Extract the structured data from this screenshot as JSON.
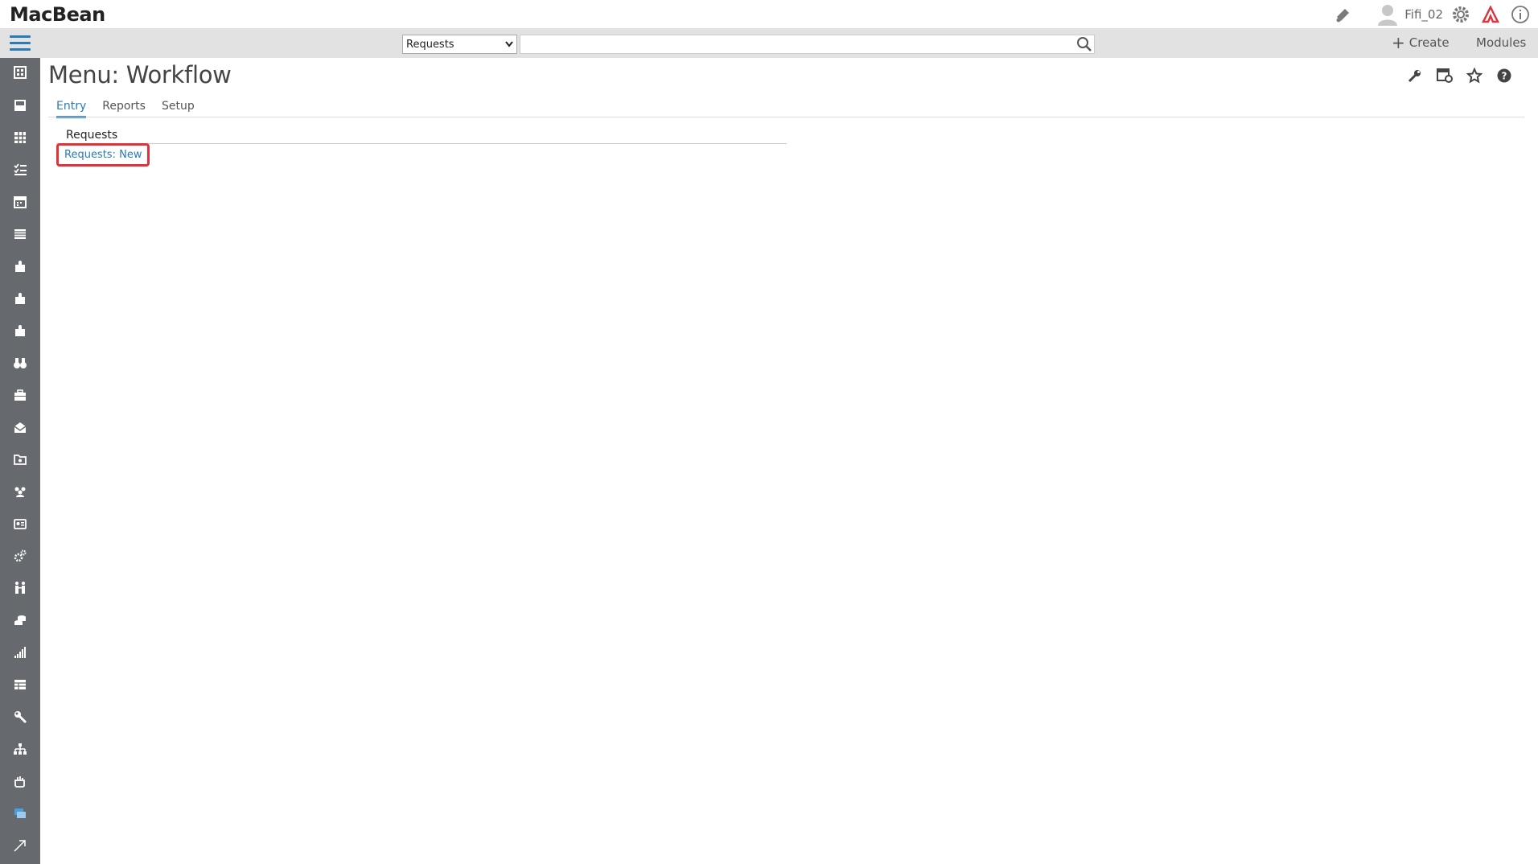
{
  "app": {
    "name": "MacBean"
  },
  "header": {
    "username": "Fifi_02"
  },
  "toolbar": {
    "search_select_value": "Requests",
    "search_placeholder": "",
    "create_label": "Create",
    "modules_label": "Modules"
  },
  "page": {
    "title": "Menu: Workflow",
    "tabs": [
      {
        "label": "Entry",
        "active": true
      },
      {
        "label": "Reports",
        "active": false
      },
      {
        "label": "Setup",
        "active": false
      }
    ],
    "section_title": "Requests",
    "link_label": "Requests: New"
  },
  "sidebar": {
    "icons": [
      "building-icon",
      "inbox-icon",
      "grid-icon",
      "checklist-icon",
      "calendar-icon",
      "list-icon",
      "puzzle-icon",
      "puzzle-icon",
      "puzzle-icon",
      "binoculars-icon",
      "briefcase-icon",
      "envelope-open-icon",
      "folder-icon",
      "team-icon",
      "id-card-icon",
      "gears-icon",
      "people-icon",
      "coins-icon",
      "bar-chart-icon",
      "table-icon",
      "wrench-icon",
      "org-chart-icon",
      "hand-icon",
      "windows-icon",
      "expand-arrow-icon"
    ]
  },
  "colors": {
    "accent": "#2a7ab8",
    "sidebar": "#666a6e",
    "toolbar": "#e2e2e2",
    "highlight": "#e0323a"
  }
}
